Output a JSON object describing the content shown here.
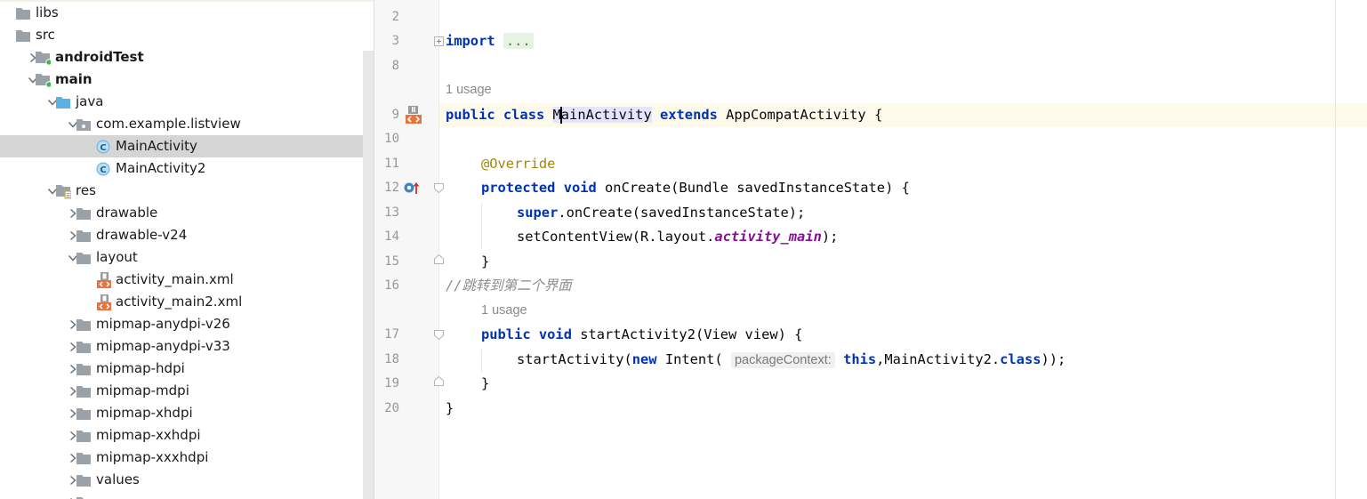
{
  "project_tree": {
    "items": [
      {
        "label": "libs",
        "icon": "folder-icon",
        "arrow": "none",
        "indent": 0,
        "bold": false,
        "selected": false
      },
      {
        "label": "src",
        "icon": "folder-icon",
        "arrow": "none",
        "indent": 0,
        "bold": false,
        "selected": false
      },
      {
        "label": "androidTest",
        "icon": "module-folder-icon",
        "arrow": "right",
        "indent": 1,
        "bold": true,
        "selected": false
      },
      {
        "label": "main",
        "icon": "module-folder-icon",
        "arrow": "down",
        "indent": 1,
        "bold": true,
        "selected": false
      },
      {
        "label": "java",
        "icon": "source-folder-icon",
        "arrow": "down",
        "indent": 2,
        "bold": false,
        "selected": false
      },
      {
        "label": "com.example.listview",
        "icon": "package-icon",
        "arrow": "down",
        "indent": 3,
        "bold": false,
        "selected": false
      },
      {
        "label": "MainActivity",
        "icon": "class-icon",
        "arrow": "none",
        "indent": 4,
        "bold": false,
        "selected": true
      },
      {
        "label": "MainActivity2",
        "icon": "class-icon",
        "arrow": "none",
        "indent": 4,
        "bold": false,
        "selected": false
      },
      {
        "label": "res",
        "icon": "resources-folder-icon",
        "arrow": "down",
        "indent": 2,
        "bold": false,
        "selected": false
      },
      {
        "label": "drawable",
        "icon": "folder-icon",
        "arrow": "right",
        "indent": 3,
        "bold": false,
        "selected": false
      },
      {
        "label": "drawable-v24",
        "icon": "folder-icon",
        "arrow": "right",
        "indent": 3,
        "bold": false,
        "selected": false
      },
      {
        "label": "layout",
        "icon": "folder-icon",
        "arrow": "down",
        "indent": 3,
        "bold": false,
        "selected": false
      },
      {
        "label": "activity_main.xml",
        "icon": "layout-xml-icon",
        "arrow": "none",
        "indent": 4,
        "bold": false,
        "selected": false
      },
      {
        "label": "activity_main2.xml",
        "icon": "layout-xml-icon",
        "arrow": "none",
        "indent": 4,
        "bold": false,
        "selected": false
      },
      {
        "label": "mipmap-anydpi-v26",
        "icon": "folder-icon",
        "arrow": "right",
        "indent": 3,
        "bold": false,
        "selected": false
      },
      {
        "label": "mipmap-anydpi-v33",
        "icon": "folder-icon",
        "arrow": "right",
        "indent": 3,
        "bold": false,
        "selected": false
      },
      {
        "label": "mipmap-hdpi",
        "icon": "folder-icon",
        "arrow": "right",
        "indent": 3,
        "bold": false,
        "selected": false
      },
      {
        "label": "mipmap-mdpi",
        "icon": "folder-icon",
        "arrow": "right",
        "indent": 3,
        "bold": false,
        "selected": false
      },
      {
        "label": "mipmap-xhdpi",
        "icon": "folder-icon",
        "arrow": "right",
        "indent": 3,
        "bold": false,
        "selected": false
      },
      {
        "label": "mipmap-xxhdpi",
        "icon": "folder-icon",
        "arrow": "right",
        "indent": 3,
        "bold": false,
        "selected": false
      },
      {
        "label": "mipmap-xxxhdpi",
        "icon": "folder-icon",
        "arrow": "right",
        "indent": 3,
        "bold": false,
        "selected": false
      },
      {
        "label": "values",
        "icon": "folder-icon",
        "arrow": "right",
        "indent": 3,
        "bold": false,
        "selected": false
      },
      {
        "label": "",
        "icon": "folder-icon",
        "arrow": "right",
        "indent": 3,
        "bold": false,
        "selected": false
      }
    ]
  },
  "editor": {
    "line_numbers": [
      "2",
      "3",
      "8",
      "9",
      "10",
      "11",
      "12",
      "13",
      "14",
      "15",
      "16",
      "17",
      "18",
      "19",
      "20"
    ],
    "usage_hints": [
      "1 usage",
      "1 usage"
    ],
    "tokens": {
      "import_kw": "import",
      "import_dots": "...",
      "public": "public",
      "class": "class",
      "class_name": "MainActivity",
      "extends": "extends",
      "superclass": "AppCompatActivity {",
      "override": "@Override",
      "protected": "protected",
      "void": "void",
      "oncreate_sig": " onCreate(Bundle savedInstanceState) {",
      "super": "super",
      "super_call": ".onCreate(savedInstanceState);",
      "setcontent_pre": "setContentView(R.layout.",
      "layout_field": "activity_main",
      "setcontent_post": ");",
      "close_brace": "}",
      "comment": "//跳转到第二个界面",
      "startact2_sig": " startActivity2(View view) {",
      "startact_pre": "startActivity(",
      "new": "new",
      "intent": " Intent( ",
      "param_hint": "packageContext:",
      "this": "this",
      "class_ref": ",MainActivity2.",
      "class_kw": "class",
      "startact_post": "));"
    },
    "colors": {
      "keyword": "#0033b3",
      "annotation": "#9e880d",
      "field": "#871094",
      "comment": "#8c8c8c",
      "caret_line": "#fdfaeb"
    }
  }
}
